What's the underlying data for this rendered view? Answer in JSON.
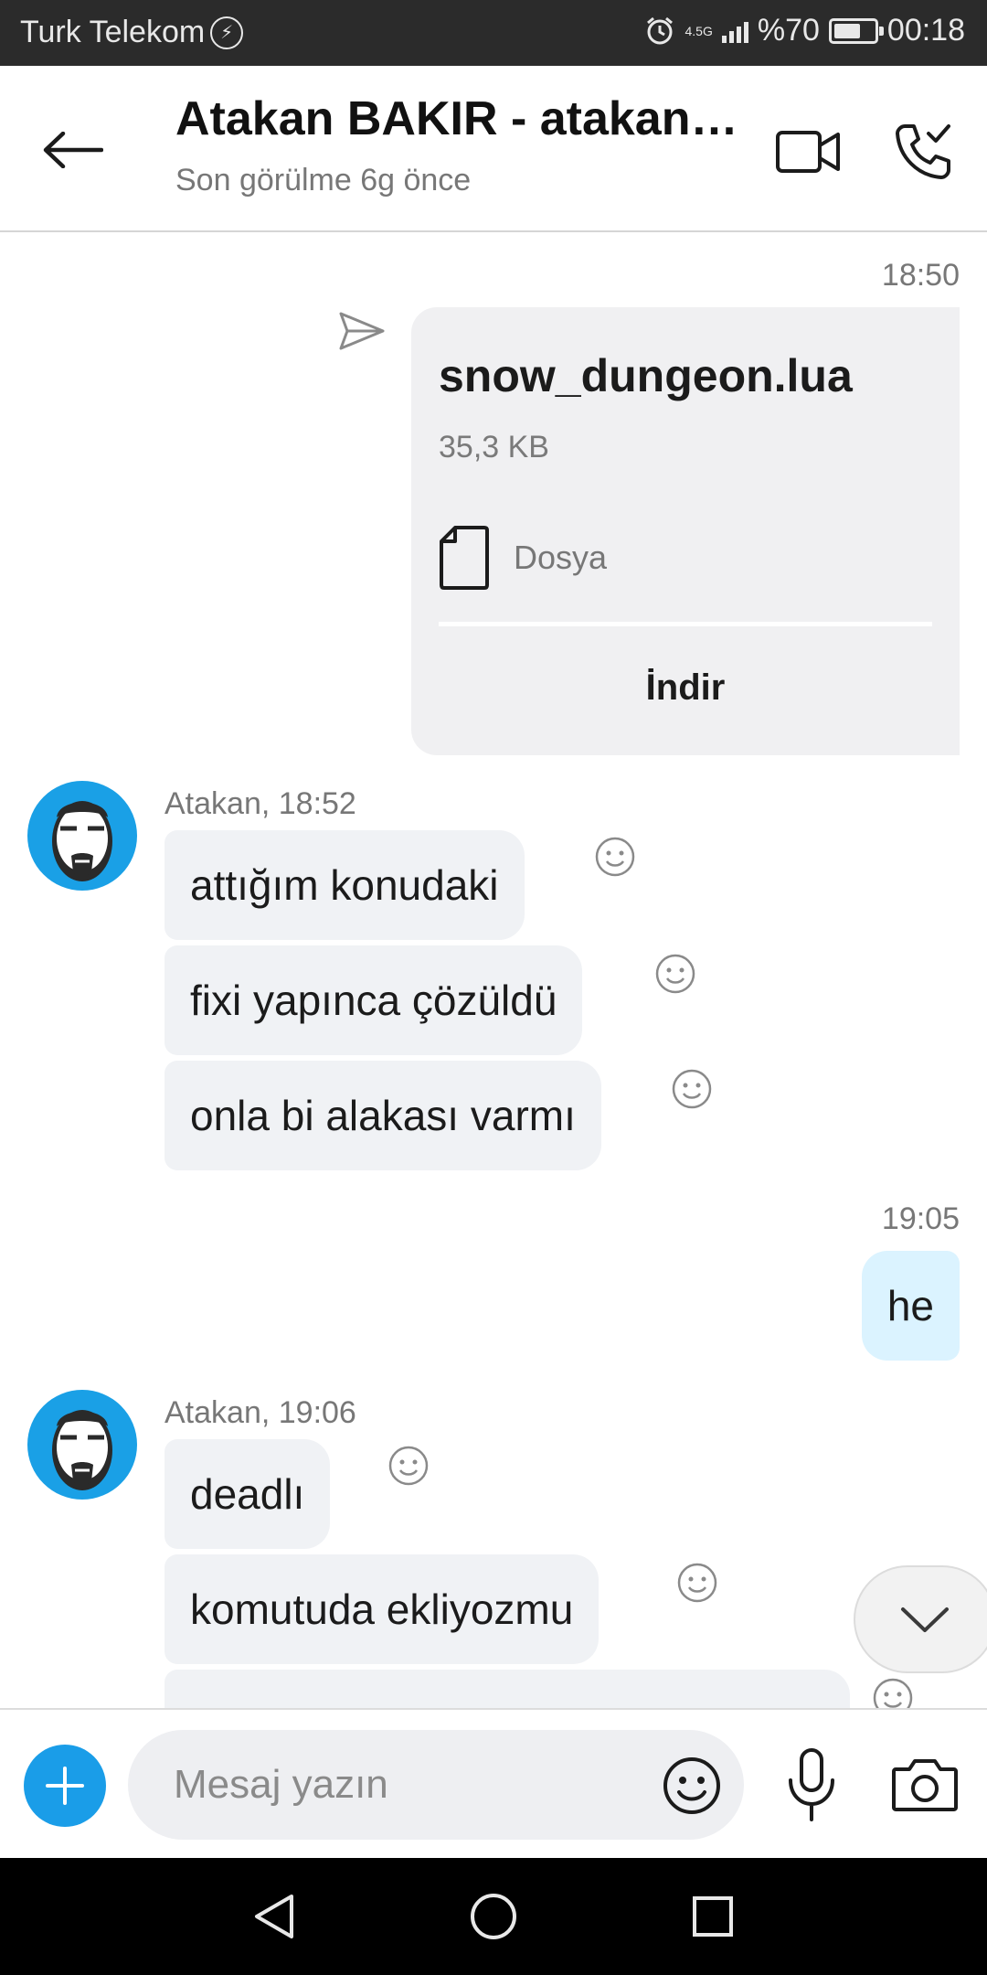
{
  "status_bar": {
    "carrier": "Turk Telekom",
    "network": "4.5G",
    "battery": "%70",
    "battery_level": 0.7,
    "time": "00:18"
  },
  "header": {
    "title": "Atakan BAKIR - atakanb...",
    "subtitle": "Son görülme 6g önce"
  },
  "messages": {
    "ts_1": "18:50",
    "file": {
      "name": "snow_dungeon.lua",
      "size": "35,3 KB",
      "type": "Dosya",
      "download": "İndir"
    },
    "group_1": {
      "sender": "Atakan, 18:52",
      "texts": [
        "attığım konudaki",
        "fixi yapınca çözüldü",
        "onla bi alakası varmı"
      ]
    },
    "ts_2": "19:05",
    "outgoing_1": "he",
    "group_2": {
      "sender": "Atakan, 19:06",
      "texts": [
        "deadlı",
        "komutuda ekliyozmu"
      ]
    }
  },
  "composer": {
    "placeholder": "Mesaj yazın"
  },
  "colors": {
    "accent": "#1a9de8",
    "incoming_bubble": "#f0f2f5",
    "outgoing_bubble": "#dbf3ff",
    "file_card": "#f0f0f2"
  }
}
